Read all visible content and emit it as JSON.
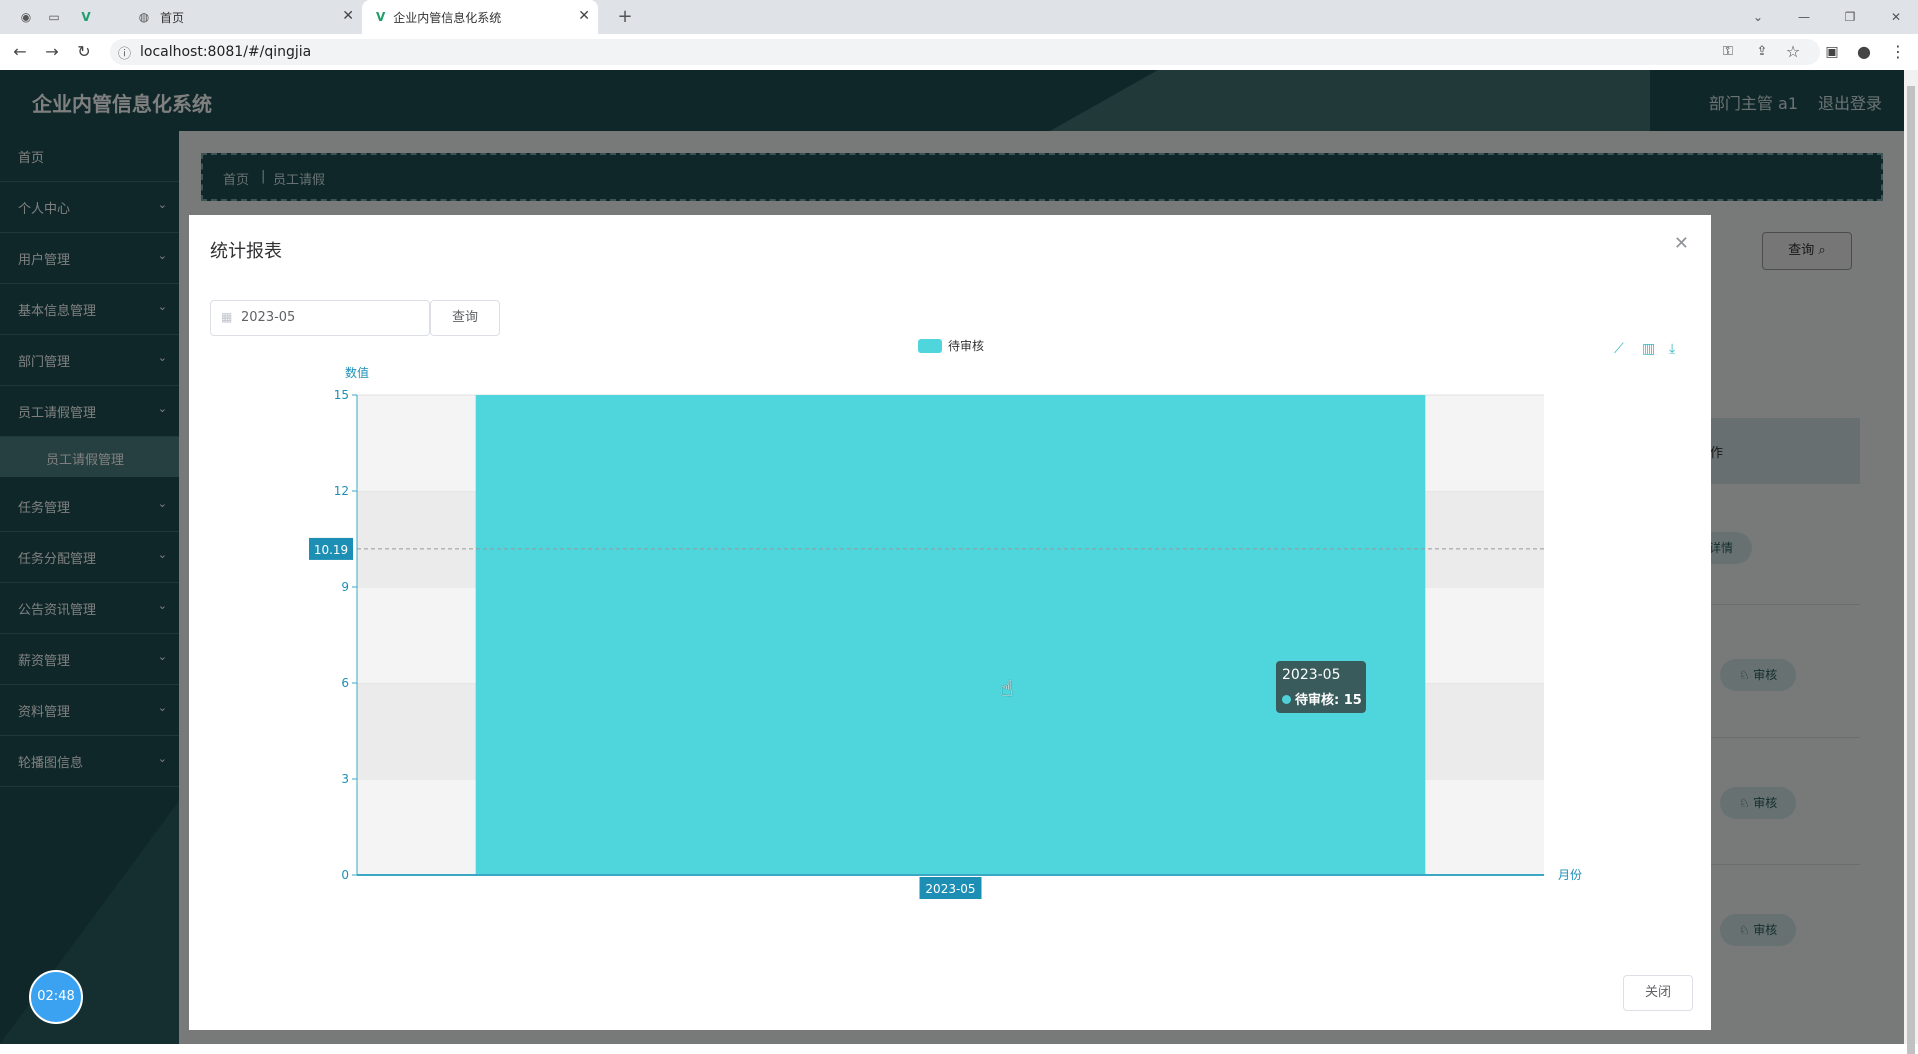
{
  "browser": {
    "tabs": [
      {
        "title": "首页"
      },
      {
        "title": "企业内管信息化系统"
      }
    ],
    "url": "localhost:8081/#/qingjia",
    "new_tab": "+"
  },
  "header": {
    "title": "企业内管信息化系统",
    "user": "部门主管 a1",
    "logout": "退出登录"
  },
  "sidebar": {
    "items": [
      {
        "label": "首页",
        "chevron": false
      },
      {
        "label": "个人中心",
        "chevron": true
      },
      {
        "label": "用户管理",
        "chevron": true
      },
      {
        "label": "基本信息管理",
        "chevron": true
      },
      {
        "label": "部门管理",
        "chevron": true
      },
      {
        "label": "员工请假管理",
        "chevron": true
      },
      {
        "label": "任务管理",
        "chevron": true
      },
      {
        "label": "任务分配管理",
        "chevron": true
      },
      {
        "label": "公告资讯管理",
        "chevron": true
      },
      {
        "label": "薪资管理",
        "chevron": true
      },
      {
        "label": "资料管理",
        "chevron": true
      },
      {
        "label": "轮播图信息",
        "chevron": true
      }
    ],
    "active_sub": "员工请假管理"
  },
  "breadcrumb": {
    "home": "首页",
    "current": "员工请假"
  },
  "background": {
    "query_button": "查询",
    "ops_header": "作",
    "details": "详情",
    "review": "审核"
  },
  "timer": "02:48",
  "dialog": {
    "title": "统计报表",
    "date_value": "2023-05",
    "query_label": "查询",
    "close_label": "关闭"
  },
  "chart_data": {
    "type": "bar",
    "categories": [
      "2023-05"
    ],
    "series": [
      {
        "name": "待审核",
        "values": [
          15
        ],
        "color": "#4fd5dc"
      }
    ],
    "ylabel": "数值",
    "xlabel": "月份",
    "ylim": [
      0,
      15
    ],
    "yticks": [
      0,
      3,
      6,
      9,
      12,
      15
    ],
    "axis_pointer": {
      "y_label": "10.19",
      "x_label": "2023-05"
    },
    "tooltip": {
      "title": "2023-05",
      "series": "待审核",
      "value": 15
    },
    "legend_position": "top-center",
    "grid": "horizontal split areas"
  }
}
